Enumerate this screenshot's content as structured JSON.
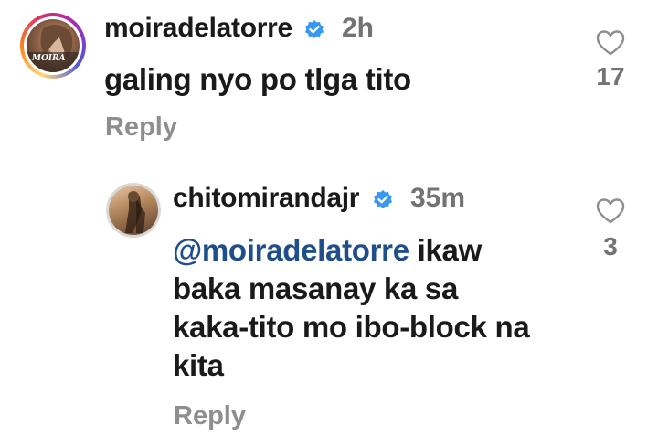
{
  "comment": {
    "username": "moiradelatorre",
    "time": "2h",
    "text": "galing nyo po tlga tito",
    "reply_label": "Reply",
    "likes": "17",
    "avatar_text": "MOIRA",
    "verified_icon": "verified-badge-icon",
    "like_icon": "heart-outline-icon"
  },
  "reply_comment": {
    "username": "chitomirandajr",
    "time": "35m",
    "mention": "@moiradelatorre",
    "text_line1_rest": " ikaw",
    "text_line2": "baka masanay ka sa",
    "text_line3": "kaka-tito mo ibo-block na",
    "text_line4": "kita",
    "reply_label": "Reply",
    "likes": "3",
    "verified_icon": "verified-badge-icon",
    "like_icon": "heart-outline-icon"
  },
  "colors": {
    "text": "#1a1a1a",
    "secondary": "#737373",
    "mention": "#1f4e8a",
    "verified": "#3897f0"
  }
}
